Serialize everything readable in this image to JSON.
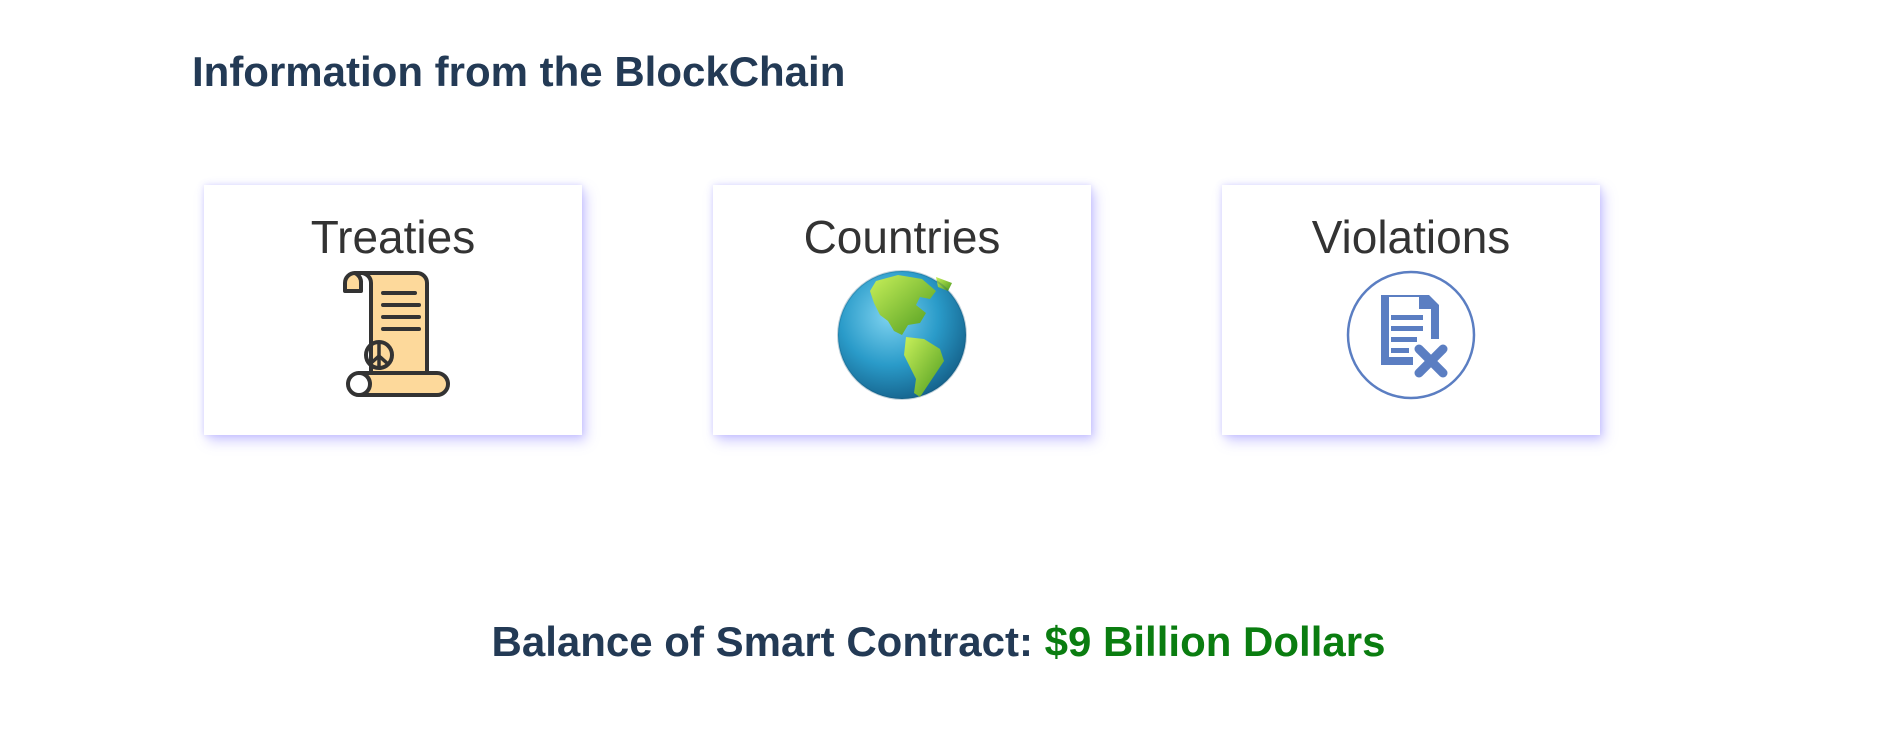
{
  "page": {
    "title": "Information from the BlockChain"
  },
  "cards": [
    {
      "label": "Treaties",
      "icon": "treaty-scroll-icon"
    },
    {
      "label": "Countries",
      "icon": "globe-icon"
    },
    {
      "label": "Violations",
      "icon": "document-violation-icon"
    }
  ],
  "balance": {
    "label": "Balance of Smart Contract:",
    "value": "$9 Billion Dollars"
  },
  "colors": {
    "heading": "#233a55",
    "balance_value": "#0a7d10",
    "card_shadow": "#786eff",
    "violation_icon": "#5b7ec2"
  }
}
